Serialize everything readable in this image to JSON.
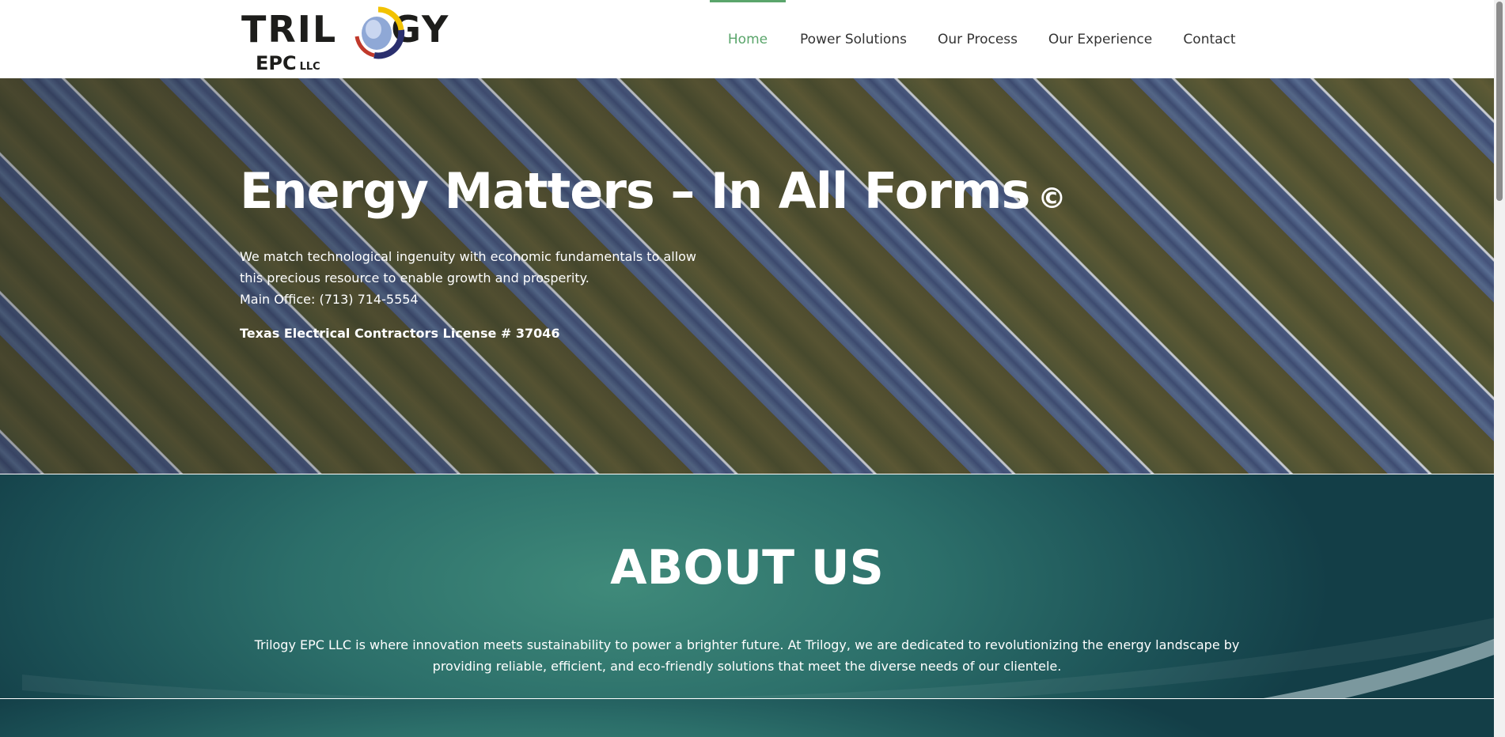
{
  "logo": {
    "word_left": "TRIL",
    "word_right": "GY",
    "sub": "EPC",
    "llc": "LLC"
  },
  "nav": {
    "items": [
      {
        "label": "Home",
        "active": true
      },
      {
        "label": "Power Solutions",
        "active": false
      },
      {
        "label": "Our Process",
        "active": false
      },
      {
        "label": "Our Experience",
        "active": false
      },
      {
        "label": "Contact",
        "active": false
      }
    ]
  },
  "hero": {
    "title": "Energy Matters – In All Forms",
    "copyright": "©",
    "description": "We match technological ingenuity with economic fundamentals to allow this precious resource to enable growth and prosperity.",
    "phone": "Main Office: (713) 714-5554",
    "license": "Texas Electrical Contractors License # 37046"
  },
  "about": {
    "title": "ABOUT US",
    "text": "Trilogy EPC LLC is where innovation meets sustainability to power a brighter future. At Trilogy, we are dedicated to revolutionizing the energy landscape by providing reliable, efficient, and eco-friendly solutions that meet the diverse needs of our clientele."
  },
  "colors": {
    "accent": "#5aa56b",
    "nav_text": "#333333",
    "about_bg": "#2c6f6a"
  }
}
